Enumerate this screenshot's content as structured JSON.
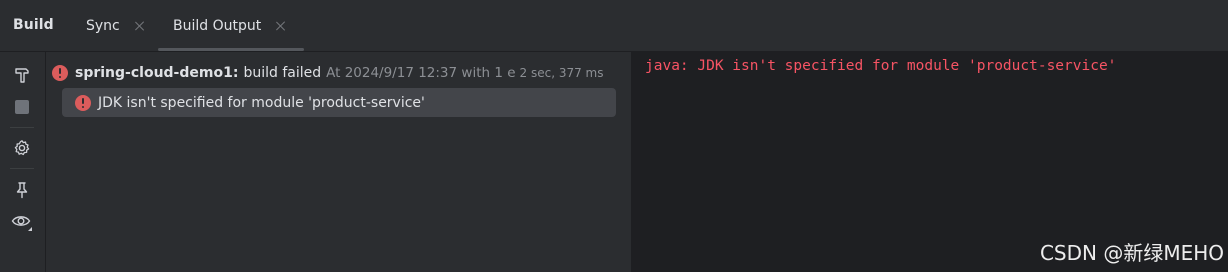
{
  "header": {
    "panel_title": "Build",
    "tabs": [
      {
        "label": "Sync"
      },
      {
        "label": "Build Output"
      }
    ]
  },
  "toolbar": {
    "icons": [
      "hammer-icon",
      "stop-icon",
      "settings-icon",
      "pin-icon",
      "eye-icon"
    ]
  },
  "tree": {
    "root": {
      "project": "spring-cloud-demo1:",
      "status": "build failed",
      "timestamp": "At 2024/9/17 12:37 with 1 e",
      "duration": "2 sec, 377 ms"
    },
    "child": {
      "message": "JDK isn't specified for module 'product-service'"
    }
  },
  "console": {
    "line": "java: JDK isn't specified for module 'product-service'"
  },
  "watermark": "CSDN @新绿MEHO",
  "colors": {
    "error": "#db5c5c",
    "console_error_text": "#f75464",
    "panel_bg": "#2b2d30",
    "console_bg": "#1e1f22",
    "selected_row": "#43454a"
  }
}
